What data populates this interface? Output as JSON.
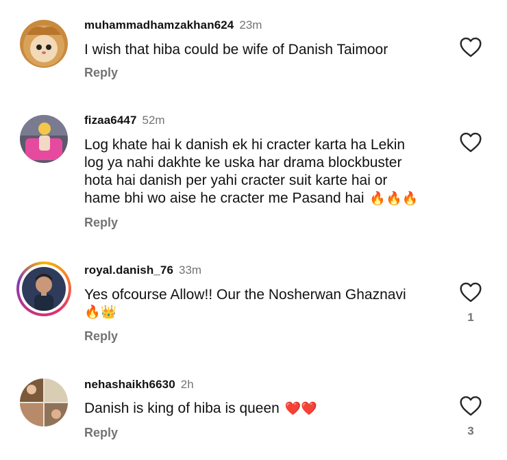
{
  "comments": [
    {
      "username": "muhammadhamzakhan624",
      "time": "23m",
      "text": "I wish that hiba could be wife of Danish Taimoor",
      "emoji": "",
      "reply_label": "Reply",
      "like_count": ""
    },
    {
      "username": "fizaa6447",
      "time": "52m",
      "text_lines": [
        "Log khate hai k danish ek hi cracter karta ha Lekin",
        "log ya nahi dakhte ke uska har drama blockbuster",
        "hota hai danish per yahi cracter suit karte hai or",
        "hame bhi wo aise he cracter me Pasand hai"
      ],
      "emoji": "🔥🔥🔥",
      "reply_label": "Reply",
      "like_count": ""
    },
    {
      "username": "royal.danish_76",
      "time": "33m",
      "text": "Yes ofcourse Allow!! Our the Nosherwan Ghaznavi",
      "emoji": "🔥👑",
      "reply_label": "Reply",
      "like_count": "1"
    },
    {
      "username": "nehashaikh6630",
      "time": "2h",
      "text": "Danish is king of hiba is queen",
      "emoji": "❤️❤️",
      "reply_label": "Reply",
      "like_count": "3"
    }
  ],
  "icons": {
    "like": "heart-outline-icon"
  }
}
